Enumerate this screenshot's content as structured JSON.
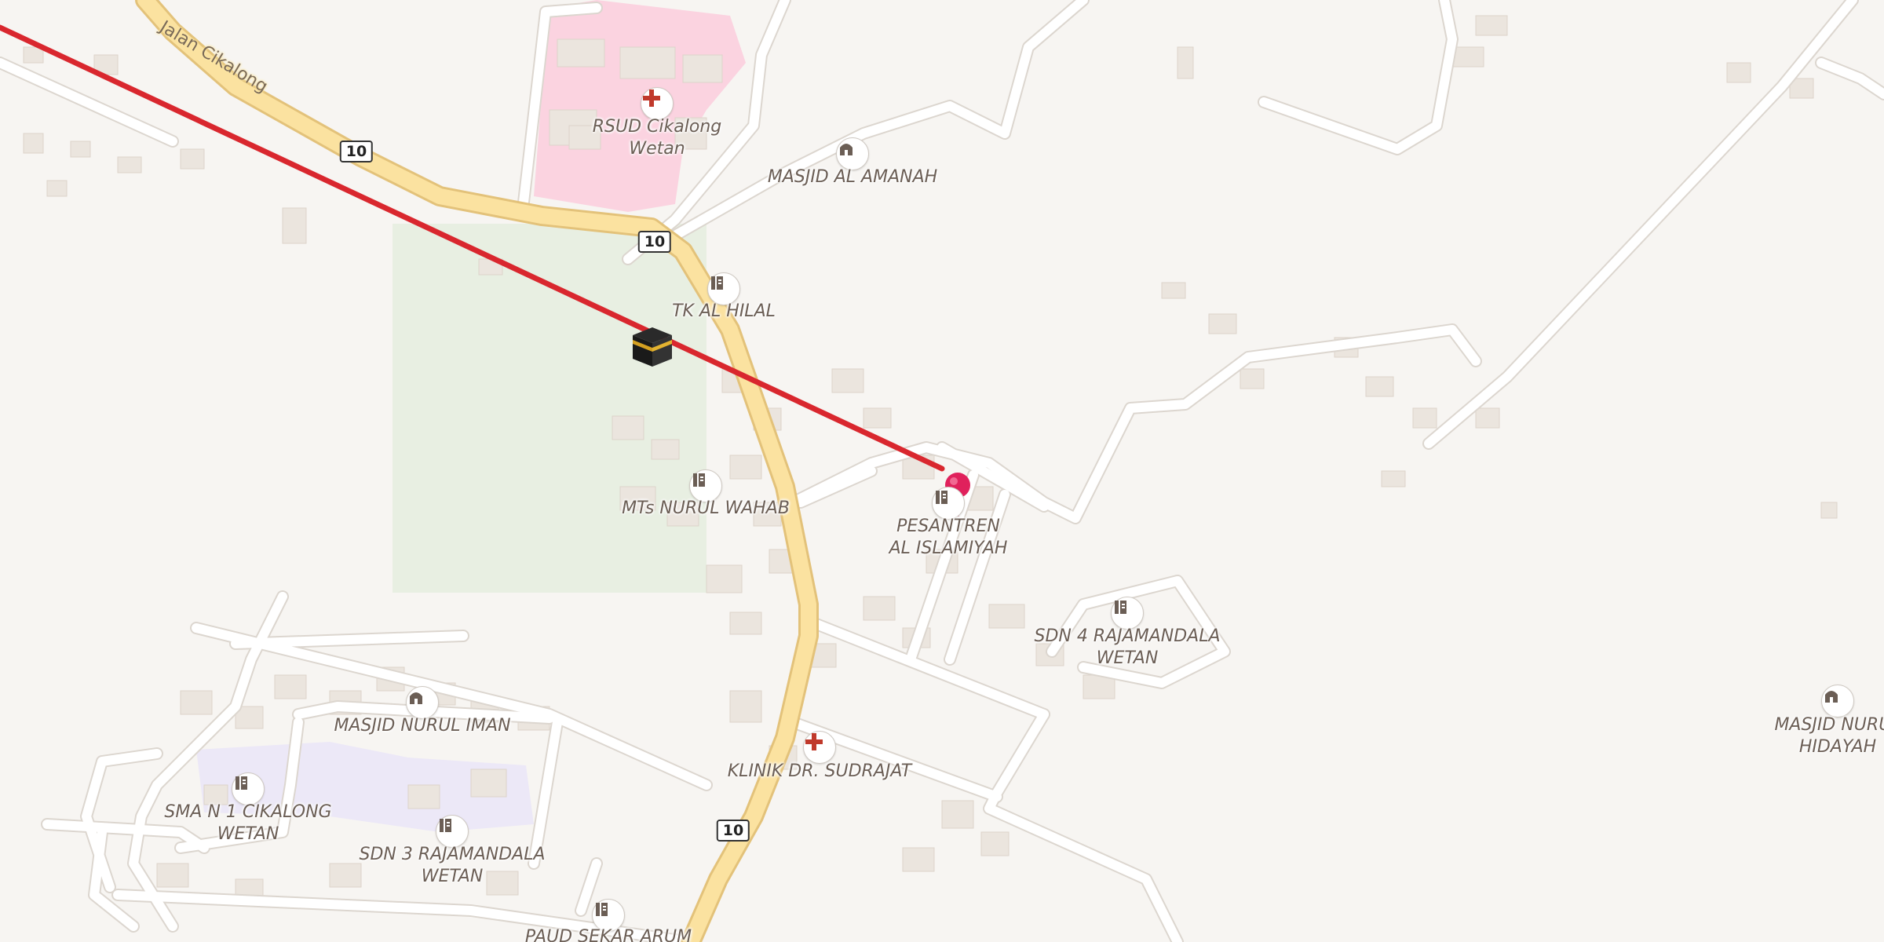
{
  "street": {
    "name": "Jalan Cikalong"
  },
  "route_shields": [
    "10",
    "10",
    "10"
  ],
  "pois": {
    "hospital": {
      "name_line1": "RSUD Cikalong",
      "name_line2": "Wetan",
      "icon": "hospital-icon"
    },
    "masjid_al_amanah": {
      "name": "MASJID AL AMANAH",
      "icon": "mosque-icon"
    },
    "tk_al_hilal": {
      "name": "TK AL HILAL",
      "icon": "school-icon"
    },
    "mts_nurul_wahab": {
      "name": "MTs NURUL WAHAB",
      "icon": "school-icon"
    },
    "pesantren": {
      "name_line1": "PESANTREN",
      "name_line2": "AL ISLAMIYAH",
      "icon": "school-icon"
    },
    "sdn4": {
      "name_line1": "SDN 4 RAJAMANDALA",
      "name_line2": "WETAN",
      "icon": "school-icon"
    },
    "masjid_nurul_hidayah": {
      "name_line1": "MASJID NURUL",
      "name_line2": "HIDAYAH",
      "icon": "mosque-icon"
    },
    "masjid_nurul_iman": {
      "name": "MASJID NURUL IMAN",
      "icon": "mosque-icon"
    },
    "klinik": {
      "name": "KLINIK DR. SUDRAJAT",
      "icon": "hospital-icon"
    },
    "sma1": {
      "name_line1": "SMA N 1 CIKALONG",
      "name_line2": "WETAN",
      "icon": "school-icon"
    },
    "sdn3": {
      "name_line1": "SDN 3 RAJAMANDALA",
      "name_line2": "WETAN",
      "icon": "school-icon"
    },
    "paud": {
      "name": "PAUD SEKAR ARUM",
      "icon": "school-icon"
    }
  },
  "qibla": {
    "line_color": "#d9272e",
    "icon": "kaaba-icon"
  },
  "marker": {
    "icon": "location-pin-icon",
    "color": "#e0215c"
  },
  "colors": {
    "background": "#f7f5f2",
    "road": "#ffffff",
    "main_road": "#fbe2a0",
    "hospital_area": "#fbd3e0",
    "park": "#e8efe2",
    "school_area": "#ece8f7",
    "building": "#ebe5de"
  }
}
